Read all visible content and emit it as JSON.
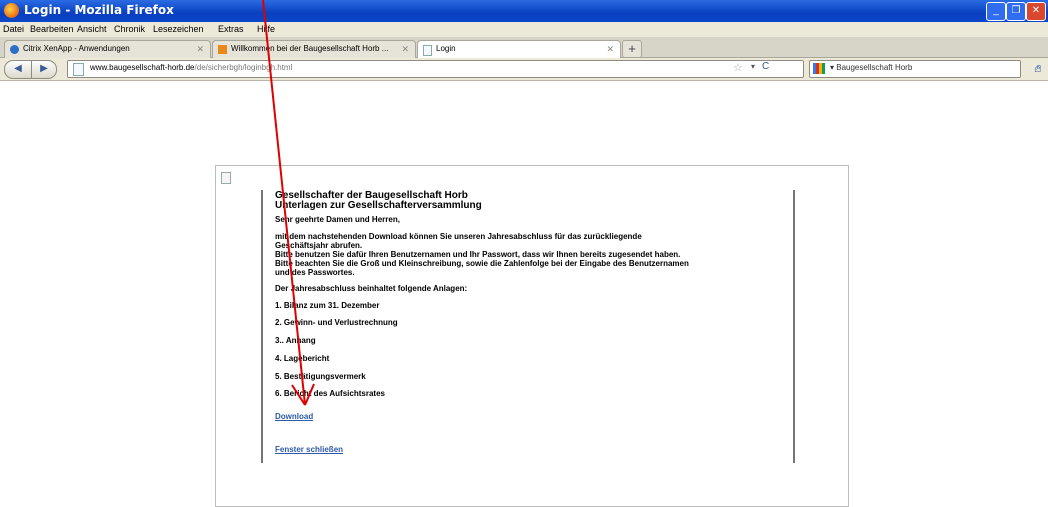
{
  "window": {
    "title": "Login - Mozilla Firefox"
  },
  "menu": [
    "Datei",
    "Bearbeiten",
    "Ansicht",
    "Chronik",
    "Lesezeichen",
    "Extras",
    "Hilfe"
  ],
  "tabs": [
    {
      "label": "Citrix XenApp - Anwendungen",
      "icon": "citrix-icon",
      "active": false
    },
    {
      "label": "Willkommen bei der Baugesellschaft Horb ...",
      "icon": "site-icon",
      "active": false
    },
    {
      "label": "Login",
      "icon": "page-icon",
      "active": true
    }
  ],
  "nav": {
    "url_host": "www.baugesellschaft-horb.de",
    "url_path": "/de/sicherbgh/loginbgh.html",
    "search_label": "Baugesellschaft Horb"
  },
  "page": {
    "heading1": "Gesellschafter der Baugesellschaft Horb",
    "heading2": "Unterlagen zur Gesellschafterversammlung",
    "greeting": "Sehr geehrte Damen und Herren,",
    "para1_line1": "mit dem nachstehenden Download können Sie unseren Jahresabschluss für das zurückliegende",
    "para1_line2": "Geschäftsjahr abrufen.",
    "para1_line3": "Bitte benutzen Sie dafür Ihren Benutzernamen und Ihr Passwort, dass wir Ihnen bereits zugesendet haben.",
    "para1_line4": "Bitte beachten Sie die Groß und Kleinschreibung, sowie die Zahlenfolge bei der Eingabe des Benutzernamen",
    "para1_line5": "und des Passwortes.",
    "attachments_intro": "Der Jahresabschluss beinhaltet folgende Anlagen:",
    "items": [
      "1. Bilanz zum 31. Dezember",
      "2. Gewinn- und Verlustrechnung",
      "3.. Anhang",
      "4. Lagebericht",
      "5. Bestätigungsvermerk",
      "6. Bericht des Aufsichtsrates"
    ],
    "download_link": "Download",
    "close_link": "Fenster schließen"
  },
  "colors": {
    "accent_red": "#e00000",
    "link": "#2e5aa8",
    "titlebar": "#0a3fbf"
  }
}
